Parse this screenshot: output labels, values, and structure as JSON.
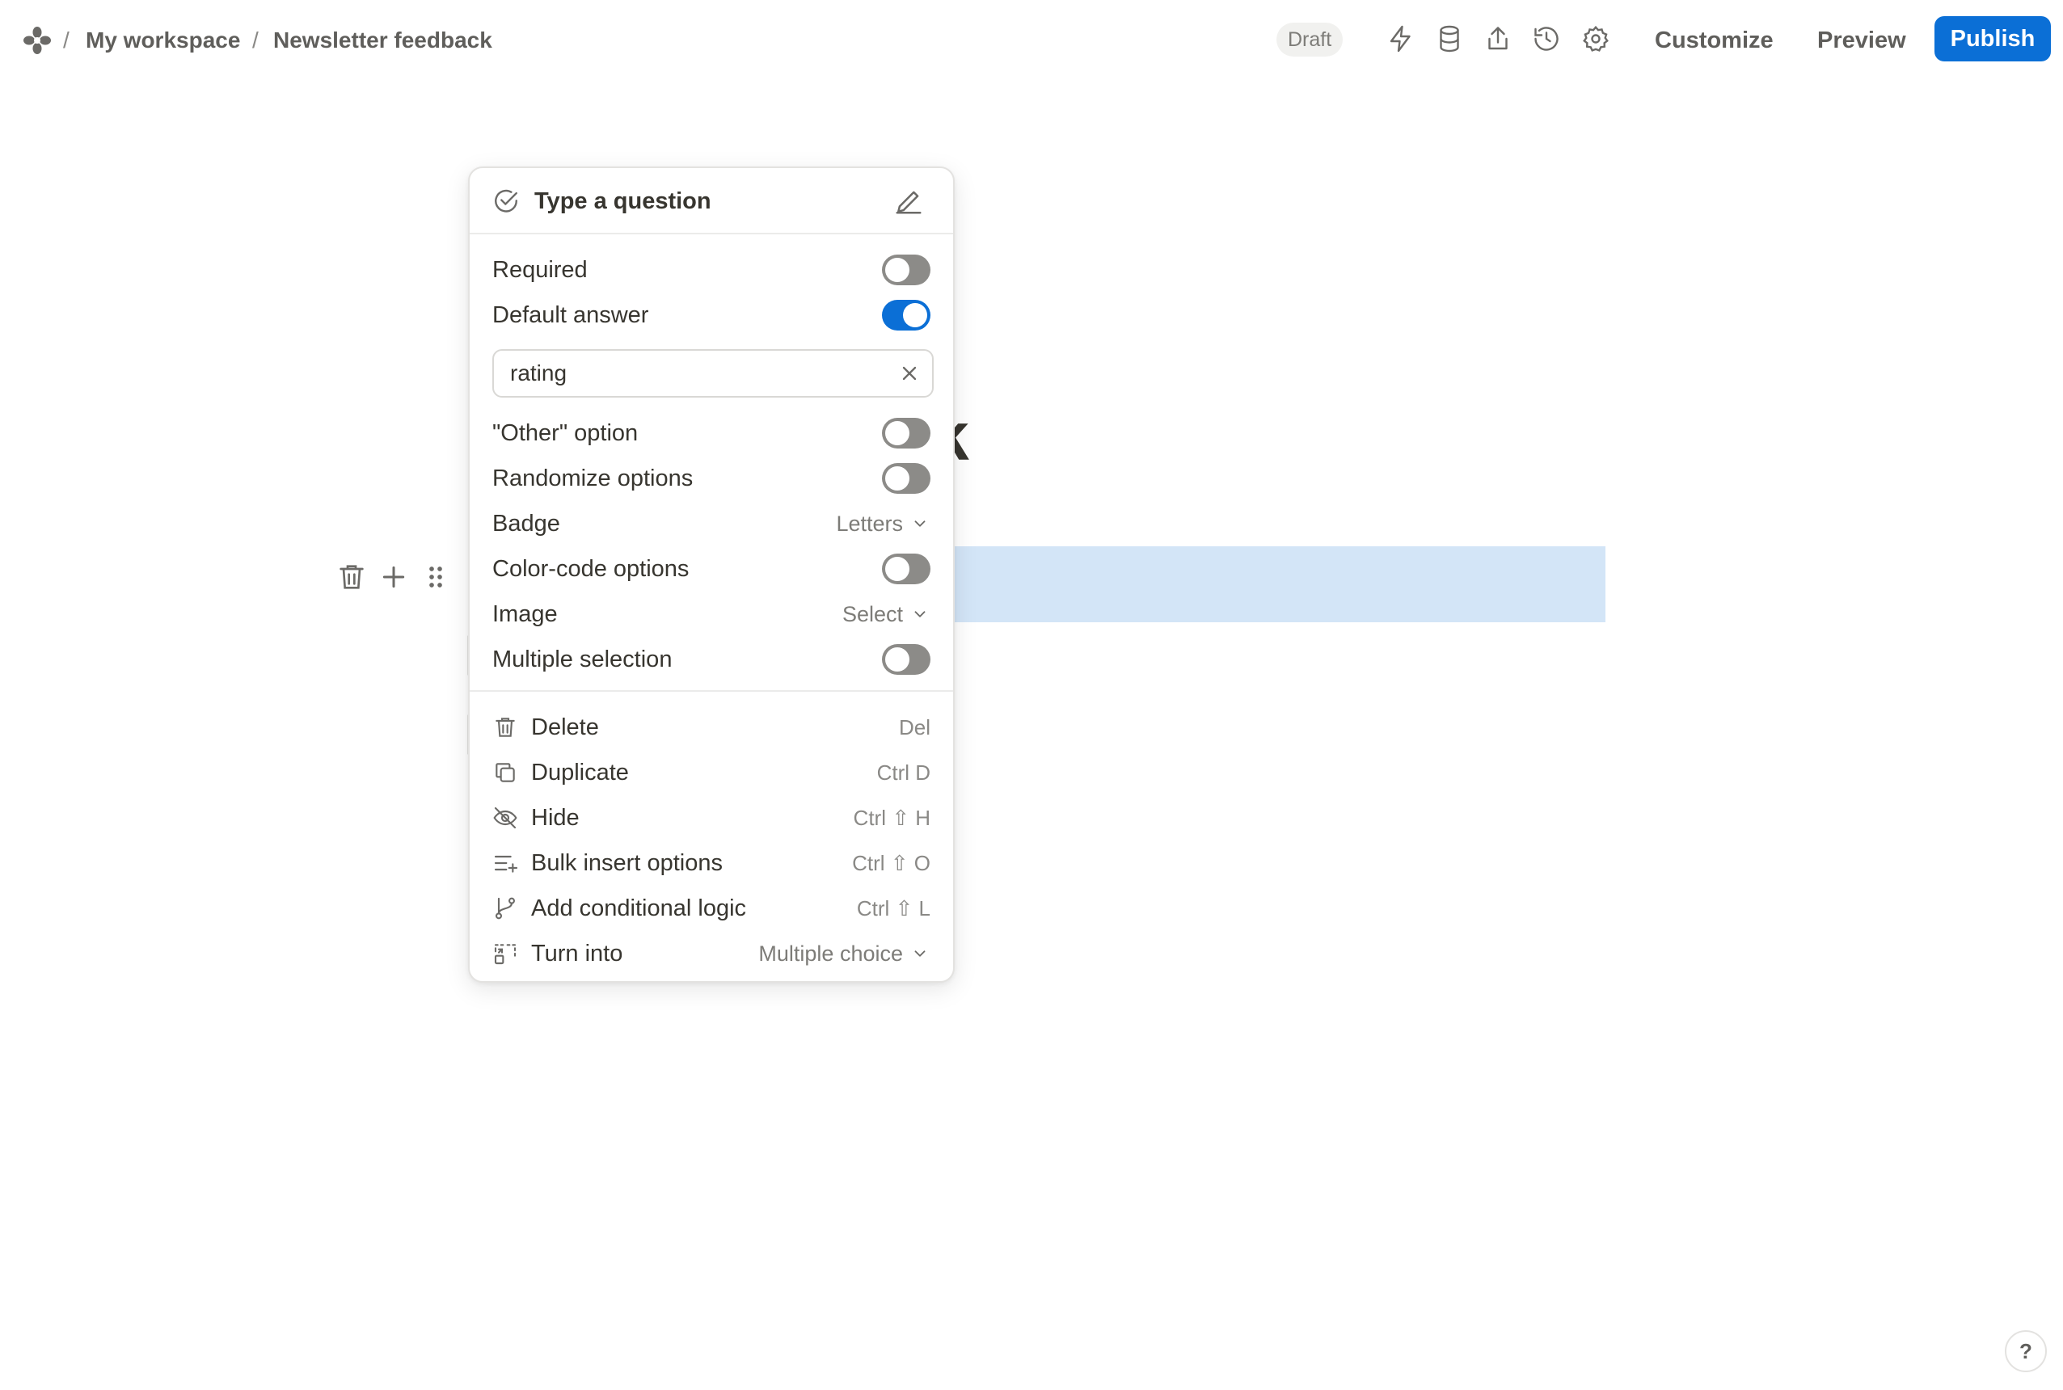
{
  "header": {
    "workspace": "My workspace",
    "form_name": "Newsletter feedback",
    "status_badge": "Draft",
    "customize_label": "Customize",
    "preview_label": "Preview",
    "publish_label": "Publish",
    "accent_color": "#0b6fd6"
  },
  "canvas": {
    "title_fragment": "dback"
  },
  "menu": {
    "question_placeholder": "Type a question",
    "settings": [
      {
        "label": "Required",
        "type": "toggle",
        "on": false
      },
      {
        "label": "Default answer",
        "type": "toggle",
        "on": true
      },
      {
        "label": "\"Other\" option",
        "type": "toggle",
        "on": false
      },
      {
        "label": "Randomize options",
        "type": "toggle",
        "on": false
      },
      {
        "label": "Badge",
        "type": "dropdown",
        "value": "Letters"
      },
      {
        "label": "Color-code options",
        "type": "toggle",
        "on": false
      },
      {
        "label": "Image",
        "type": "dropdown",
        "value": "Select"
      },
      {
        "label": "Multiple selection",
        "type": "toggle",
        "on": false
      }
    ],
    "default_answer_value": "rating",
    "actions": [
      {
        "label": "Delete",
        "shortcut": "Del",
        "icon": "trash-icon"
      },
      {
        "label": "Duplicate",
        "shortcut": "Ctrl D",
        "icon": "duplicate-icon"
      },
      {
        "label": "Hide",
        "shortcut": "Ctrl ⇧ H",
        "icon": "eye-off-icon"
      },
      {
        "label": "Bulk insert options",
        "shortcut": "Ctrl ⇧ O",
        "icon": "list-plus-icon"
      },
      {
        "label": "Add conditional logic",
        "shortcut": "Ctrl ⇧ L",
        "icon": "branch-icon"
      },
      {
        "label": "Turn into",
        "value": "Multiple choice",
        "icon": "transform-icon"
      }
    ]
  },
  "help_label": "?"
}
